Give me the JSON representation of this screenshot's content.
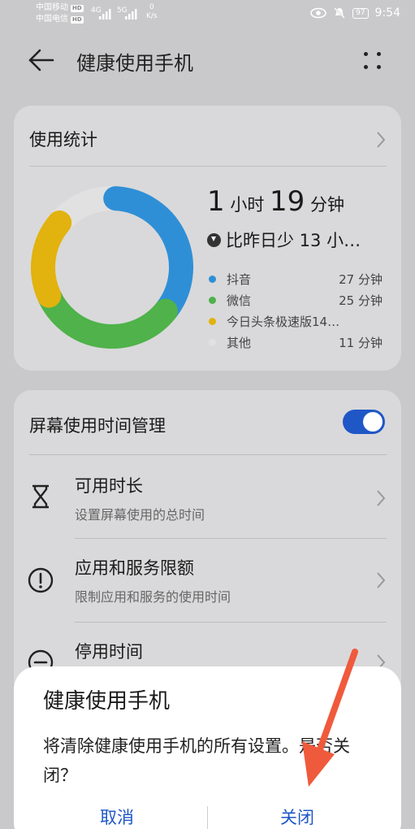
{
  "status_bar": {
    "carrier1": "中国移动",
    "carrier2": "中国电信",
    "hd": "HD",
    "net1": "4G",
    "net2": "5G",
    "speed_value": "0",
    "speed_unit": "K/s",
    "battery": "97",
    "time": "9:54"
  },
  "header": {
    "title": "健康使用手机"
  },
  "usage_card": {
    "title": "使用统计",
    "total_hours": "1",
    "hours_unit": "小时",
    "total_minutes": "19",
    "minutes_unit": "分钟",
    "compare": "比昨日少 13 小…",
    "legend": [
      {
        "name": "抖音",
        "value": "27 分钟",
        "minutes": 27,
        "color": "#2f8fd6"
      },
      {
        "name": "微信",
        "value": "25 分钟",
        "minutes": 25,
        "color": "#4fb24a"
      },
      {
        "name": "今日头条极速版14…",
        "value": "",
        "minutes": 14,
        "color": "#e2b20e"
      },
      {
        "name": "其他",
        "value": "11 分钟",
        "minutes": 11,
        "color": "#e1e1e1"
      }
    ]
  },
  "screen_time_card": {
    "title": "屏幕使用时间管理",
    "toggle_on": true,
    "items": [
      {
        "title": "可用时长",
        "subtitle": "设置屏幕使用的总时间"
      },
      {
        "title": "应用和服务限额",
        "subtitle": "限制应用和服务的使用时间"
      },
      {
        "title": "停用时间",
        "subtitle": ""
      }
    ]
  },
  "dialog": {
    "title": "健康使用手机",
    "message": "将清除健康使用手机的所有设置。是否关闭？",
    "cancel_label": "取消",
    "confirm_label": "关闭"
  },
  "colors": {
    "accent": "#1f57c7",
    "annotation_arrow": "#f05a3c"
  }
}
